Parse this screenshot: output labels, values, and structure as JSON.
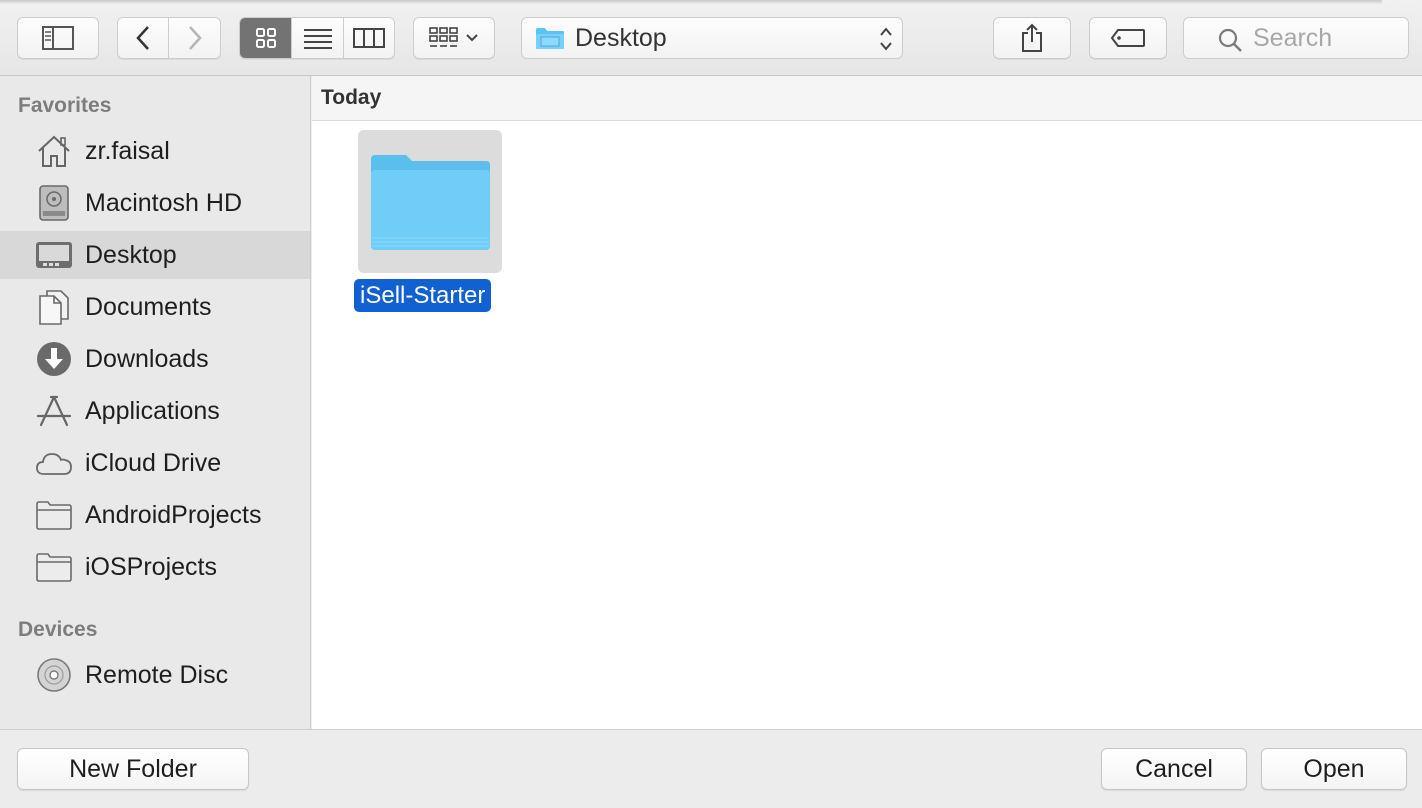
{
  "toolbar": {
    "location": "Desktop",
    "search_placeholder": "Search"
  },
  "sidebar": {
    "favorites_heading": "Favorites",
    "favorites": [
      {
        "label": "zr.faisal",
        "icon": "home-icon"
      },
      {
        "label": "Macintosh HD",
        "icon": "hard-drive-icon"
      },
      {
        "label": "Desktop",
        "icon": "desktop-icon",
        "selected": true
      },
      {
        "label": "Documents",
        "icon": "document-icon"
      },
      {
        "label": "Downloads",
        "icon": "download-icon"
      },
      {
        "label": "Applications",
        "icon": "applications-icon"
      },
      {
        "label": "iCloud Drive",
        "icon": "cloud-icon"
      },
      {
        "label": "AndroidProjects",
        "icon": "folder-icon"
      },
      {
        "label": "iOSProjects",
        "icon": "folder-icon"
      }
    ],
    "devices_heading": "Devices",
    "devices": [
      {
        "label": "Remote Disc",
        "icon": "disc-icon"
      }
    ]
  },
  "content": {
    "section_title": "Today",
    "files": [
      {
        "name": "iSell-Starter",
        "type": "folder",
        "selected": true
      }
    ]
  },
  "footer": {
    "new_folder_label": "New Folder",
    "cancel_label": "Cancel",
    "open_label": "Open"
  },
  "colors": {
    "selection_blue": "#1161d3",
    "folder_blue": "#6fcdf7",
    "active_segment": "#737373"
  }
}
